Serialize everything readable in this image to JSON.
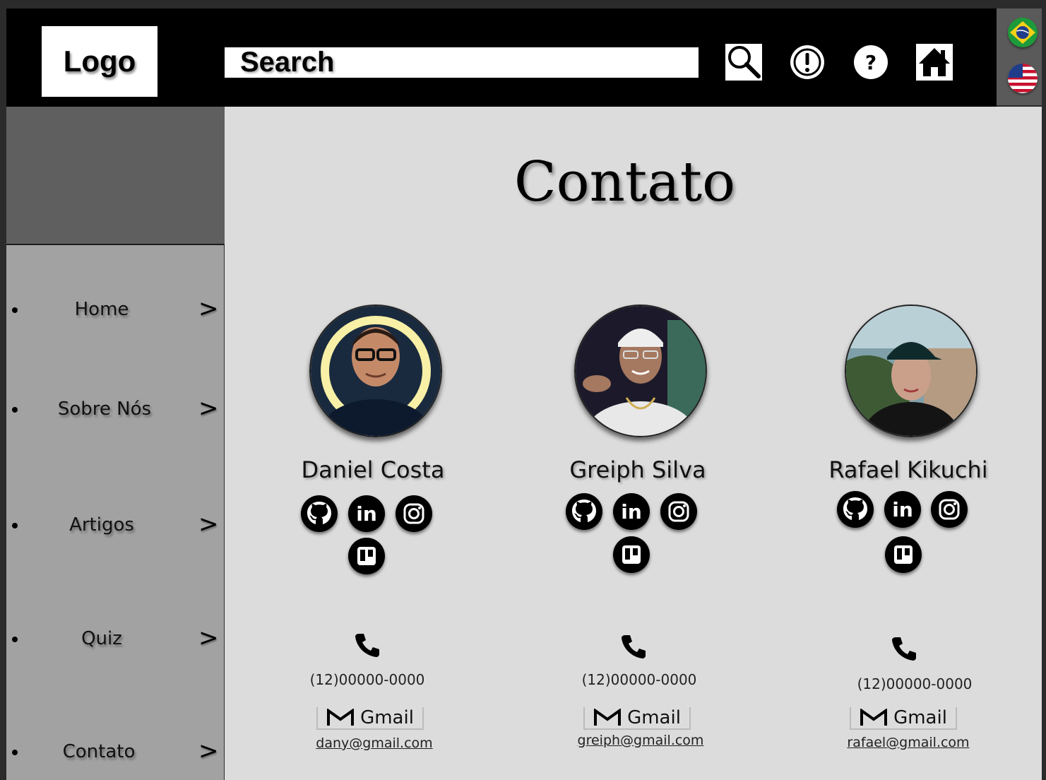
{
  "header": {
    "logo": "Logo",
    "search_placeholder": "Search",
    "icons": [
      "search-icon",
      "alert-icon",
      "help-icon",
      "home-icon"
    ]
  },
  "language": {
    "options": [
      "brazil-flag-icon",
      "usa-flag-icon"
    ]
  },
  "sidebar": {
    "items": [
      {
        "label": "Home",
        "chevron": ">"
      },
      {
        "label": "Sobre Nós",
        "chevron": ">"
      },
      {
        "label": "Artigos",
        "chevron": ">"
      },
      {
        "label": "Quiz",
        "chevron": ">"
      },
      {
        "label": "Contato",
        "chevron": ">"
      }
    ]
  },
  "main": {
    "title": "Contato",
    "people": [
      {
        "name": "Daniel Costa",
        "phone": "(12)00000-0000",
        "gmail_label": "Gmail",
        "email": "dany@gmail.com"
      },
      {
        "name": "Greiph Silva",
        "phone": "(12)00000-0000",
        "gmail_label": "Gmail",
        "email": "greiph@gmail.com"
      },
      {
        "name": "Rafael Kikuchi",
        "phone": "(12)00000-0000",
        "gmail_label": "Gmail",
        "email": "rafael@gmail.com"
      }
    ]
  },
  "colors": {
    "header_bg": "#000000",
    "sidebar_top_bg": "#5f5f5f",
    "sidebar_bg": "#a2a2a2",
    "main_bg": "#dcdcdc",
    "lang_panel_bg": "#5a5a5a"
  }
}
